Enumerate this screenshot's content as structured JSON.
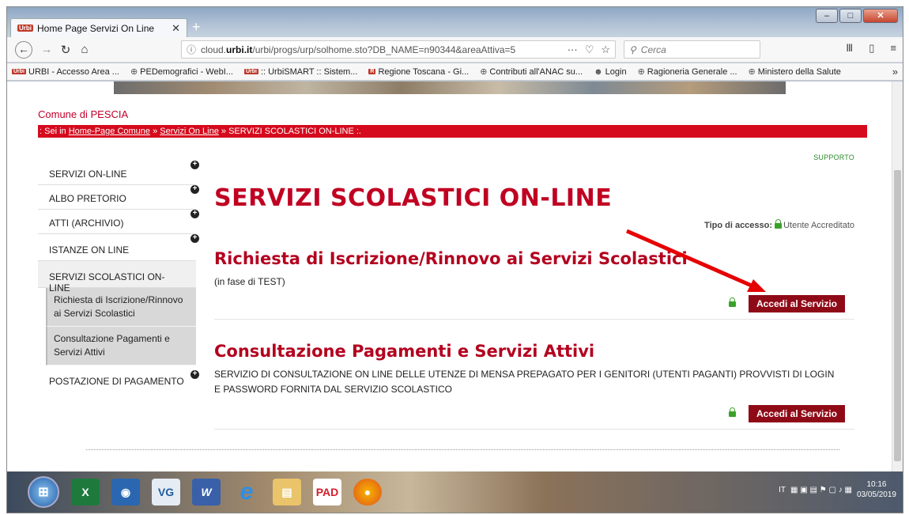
{
  "browser": {
    "tab_title": "Home Page Servizi On Line",
    "tab_favicon": "Urbi",
    "url_host": "cloud.",
    "url_domain": "urbi.it",
    "url_path": "/urbi/progs/urp/solhome.sto?DB_NAME=n90344&areaAttiva=5",
    "url_dots": "···",
    "search_placeholder": "Cerca",
    "bookmarks": [
      {
        "label": "URBI - Accesso Area ...",
        "icon": "urbi-icon"
      },
      {
        "label": "PEDemografici - WebI...",
        "icon": "globe-icon"
      },
      {
        "label": ":: UrbiSMART :: Sistem...",
        "icon": "urbi-icon"
      },
      {
        "label": "Regione Toscana - Gi...",
        "icon": "regione-icon"
      },
      {
        "label": "Contributi all'ANAC su...",
        "icon": "globe-icon"
      },
      {
        "label": "Login",
        "icon": "login-icon"
      },
      {
        "label": "Ragioneria Generale ...",
        "icon": "globe-icon"
      },
      {
        "label": "Ministero della Salute",
        "icon": "globe-icon"
      }
    ]
  },
  "page": {
    "comune": "Comune di PESCIA",
    "crumb": {
      "prefix": ": Sei in ",
      "home": "Home-Page Comune",
      "sep1": " » ",
      "servizi": "Servizi On Line",
      "sep2": " » SERVIZI SCOLASTICI ON-LINE :."
    },
    "supporto": "SUPPORTO",
    "title": "SERVIZI SCOLASTICI ON-LINE",
    "tipo_label": "Tipo di accesso:",
    "tipo_value": "Utente Accreditato",
    "sidebar": [
      {
        "label": "SERVIZI ON-LINE",
        "plus": "+"
      },
      {
        "label": "ALBO PRETORIO",
        "plus": "+"
      },
      {
        "label": "ATTI (ARCHIVIO)",
        "plus": "+"
      },
      {
        "label": "ISTANZE ON LINE",
        "plus": "+"
      },
      {
        "label": "SERVIZI SCOLASTICI ON-LINE"
      }
    ],
    "subitems": [
      "Richiesta di Iscrizione/Rinnovo ai Servizi Scolastici",
      "Consultazione Pagamenti e Servizi Attivi"
    ],
    "sidebar_last": {
      "label": "POSTAZIONE DI PAGAMENTO",
      "plus": "+"
    },
    "services": [
      {
        "title": "Richiesta di Iscrizione/Rinnovo ai Servizi Scolastici",
        "desc": "(in fase di TEST)",
        "button": "Accedi al Servizio"
      },
      {
        "title": "Consultazione Pagamenti e Servizi Attivi",
        "desc": "SERVIZIO DI CONSULTAZIONE ON LINE DELLE UTENZE DI MENSA PREPAGATO PER I GENITORI (UTENTI PAGANTI) PROVVISTI DI LOGIN E PASSWORD FORNITA DAL SERVIZIO SCOLASTICO",
        "button": "Accedi al Servizio"
      }
    ]
  },
  "taskbar": {
    "apps": [
      {
        "label": "",
        "icon": "excel-icon"
      },
      {
        "label": "",
        "icon": "outlook-icon"
      },
      {
        "label": "VG",
        "icon": "vg-icon"
      },
      {
        "label": "W",
        "icon": "word-icon"
      },
      {
        "label": "e",
        "icon": "ie-icon"
      },
      {
        "label": "",
        "icon": "explorer-icon"
      },
      {
        "label": "PAD",
        "icon": "pad-icon"
      },
      {
        "label": "",
        "icon": "firefox-icon"
      }
    ],
    "lang": "IT",
    "time": "10:16",
    "date": "03/05/2019"
  },
  "colors": {
    "brand_red": "#d50a1d",
    "title_red": "#c00022",
    "button_red": "#8f0a17",
    "arrow_red": "#e60000",
    "lock_green": "#3aa22a"
  }
}
